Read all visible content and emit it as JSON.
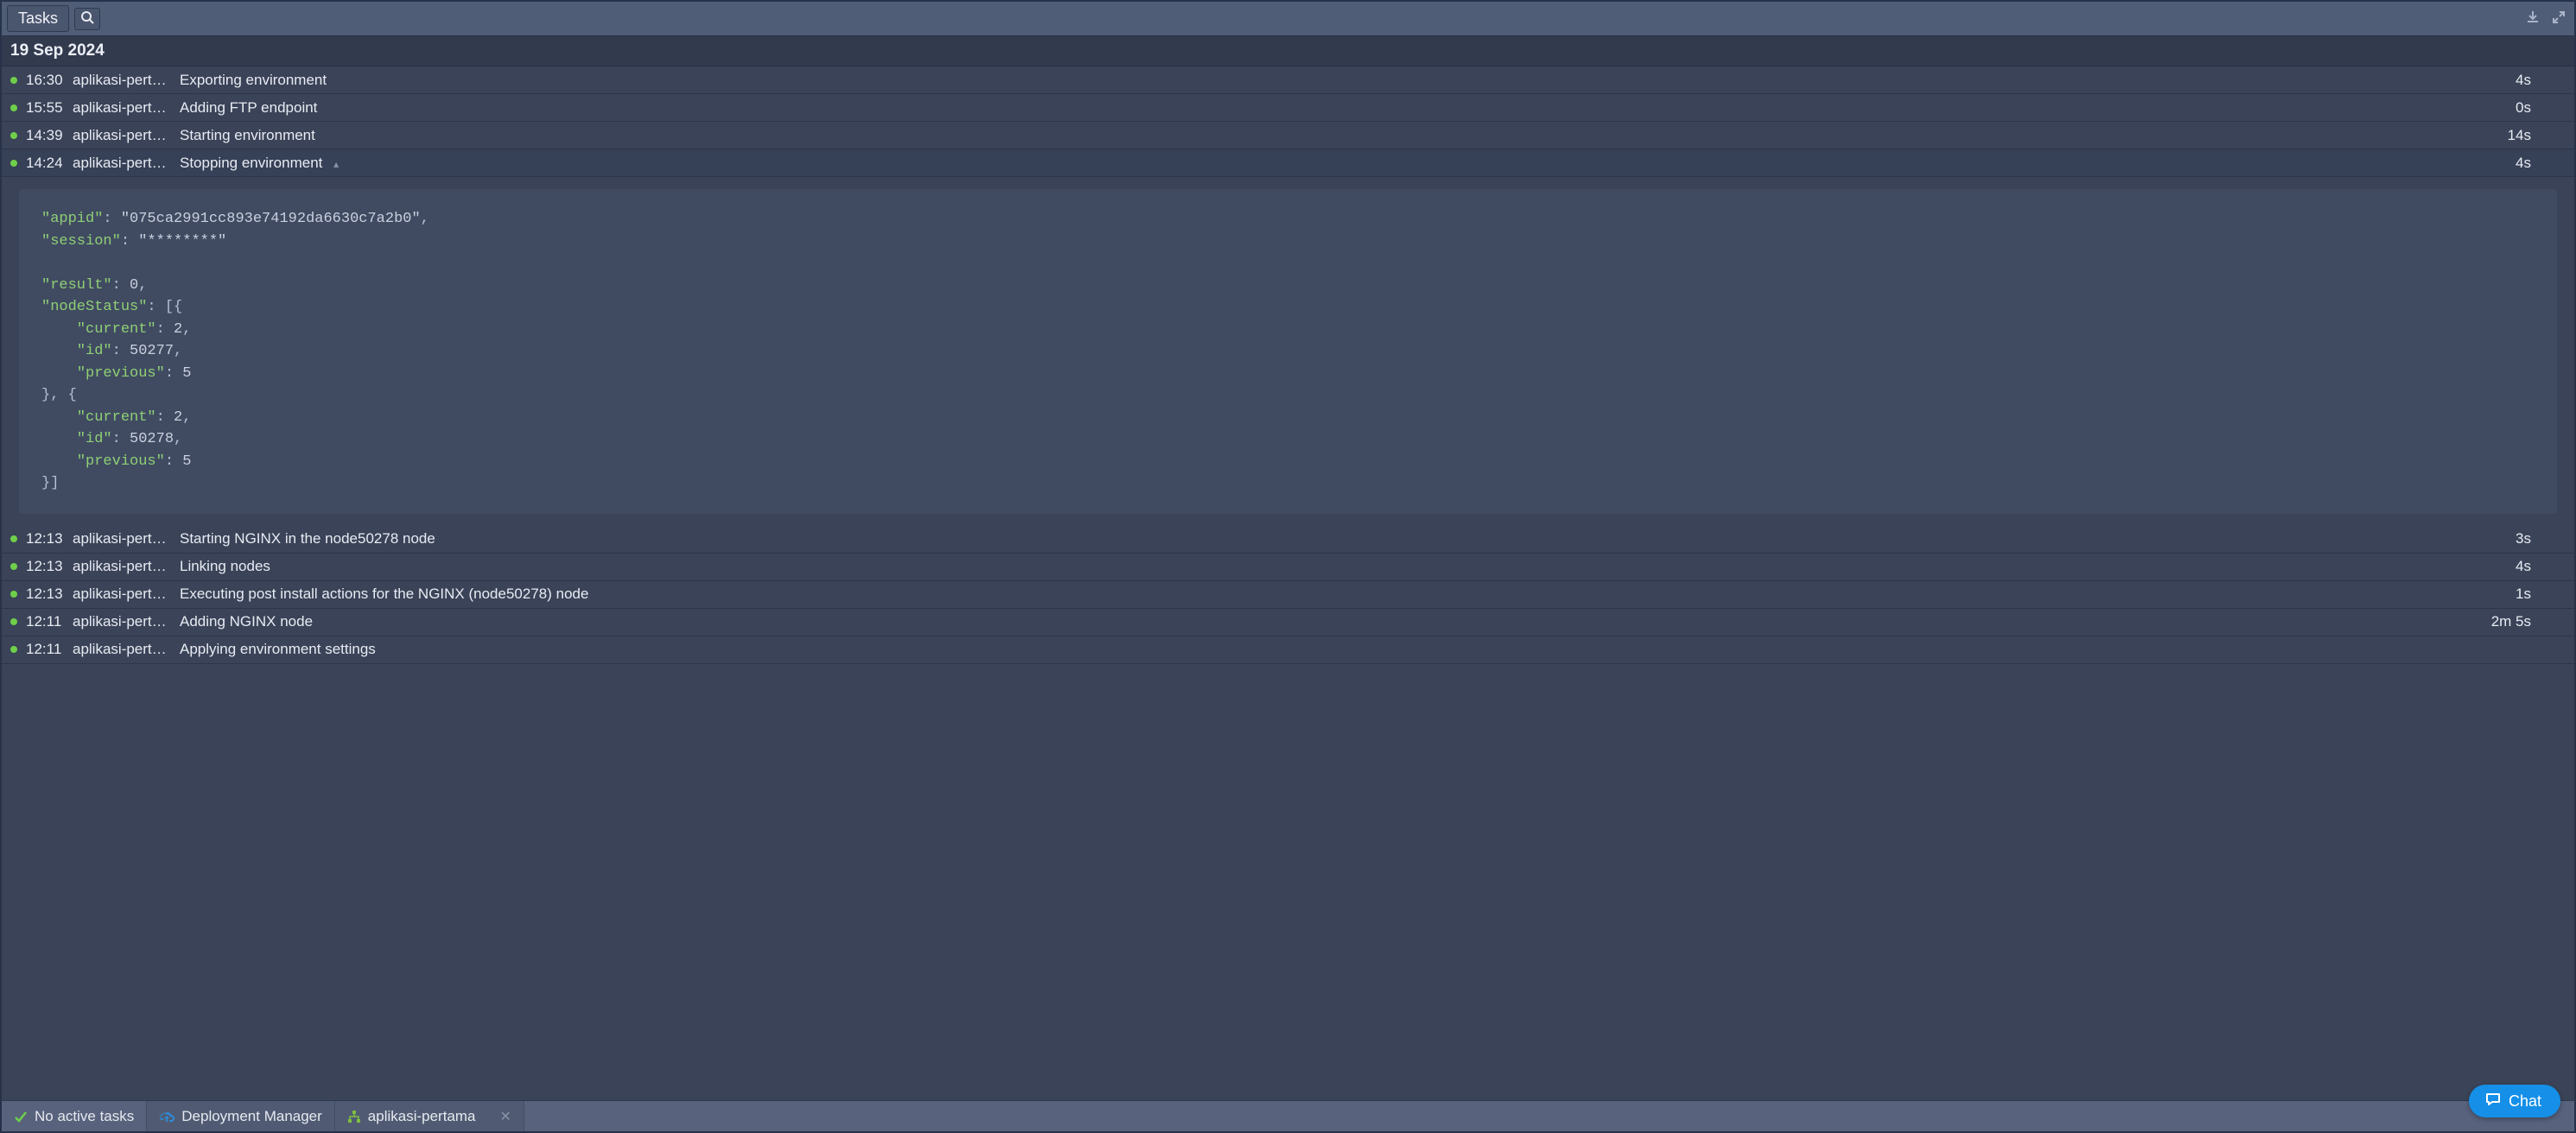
{
  "toolbar": {
    "tab_label": "Tasks"
  },
  "date_header": "19 Sep 2024",
  "rows": [
    {
      "time": "16:30",
      "app": "aplikasi-perta…",
      "desc": "Exporting environment",
      "dur": "4s",
      "status": "ok"
    },
    {
      "time": "15:55",
      "app": "aplikasi-perta…",
      "desc": "Adding FTP endpoint",
      "dur": "0s",
      "status": "ok"
    },
    {
      "time": "14:39",
      "app": "aplikasi-perta…",
      "desc": "Starting environment",
      "dur": "14s",
      "status": "ok"
    },
    {
      "time": "14:24",
      "app": "aplikasi-perta…",
      "desc": "Stopping environment",
      "dur": "4s",
      "status": "ok",
      "expanded": true
    },
    {
      "time": "12:13",
      "app": "aplikasi-perta…",
      "desc": "Starting NGINX in the node50278 node",
      "dur": "3s",
      "status": "ok"
    },
    {
      "time": "12:13",
      "app": "aplikasi-perta…",
      "desc": "Linking nodes",
      "dur": "4s",
      "status": "ok"
    },
    {
      "time": "12:13",
      "app": "aplikasi-perta…",
      "desc": "Executing post install actions for the NGINX (node50278) node",
      "dur": "1s",
      "status": "ok"
    },
    {
      "time": "12:11",
      "app": "aplikasi-perta…",
      "desc": "Adding NGINX node",
      "dur": "2m 5s",
      "status": "ok"
    },
    {
      "time": "12:11",
      "app": "aplikasi-perta…",
      "desc": "Applying environment settings",
      "dur": "",
      "status": "ok"
    }
  ],
  "details": {
    "k_appid": "\"appid\"",
    "v_appid": "\"075ca2991cc893e74192da6630c7a2b0\"",
    "k_session": "\"session\"",
    "v_session": "\"********\"",
    "k_result": "\"result\"",
    "v_result": "0",
    "k_nodeStatus": "\"nodeStatus\"",
    "k_current": "\"current\"",
    "v_cur0": "2",
    "k_id": "\"id\"",
    "v_id0": "50277",
    "k_previous": "\"previous\"",
    "v_prev0": "5",
    "v_cur1": "2",
    "v_id1": "50278",
    "v_prev1": "5"
  },
  "statusbar": {
    "no_active": "No active tasks",
    "dep_mgr": "Deployment Manager",
    "app_name": "aplikasi-pertama"
  },
  "chat_label": "Chat"
}
